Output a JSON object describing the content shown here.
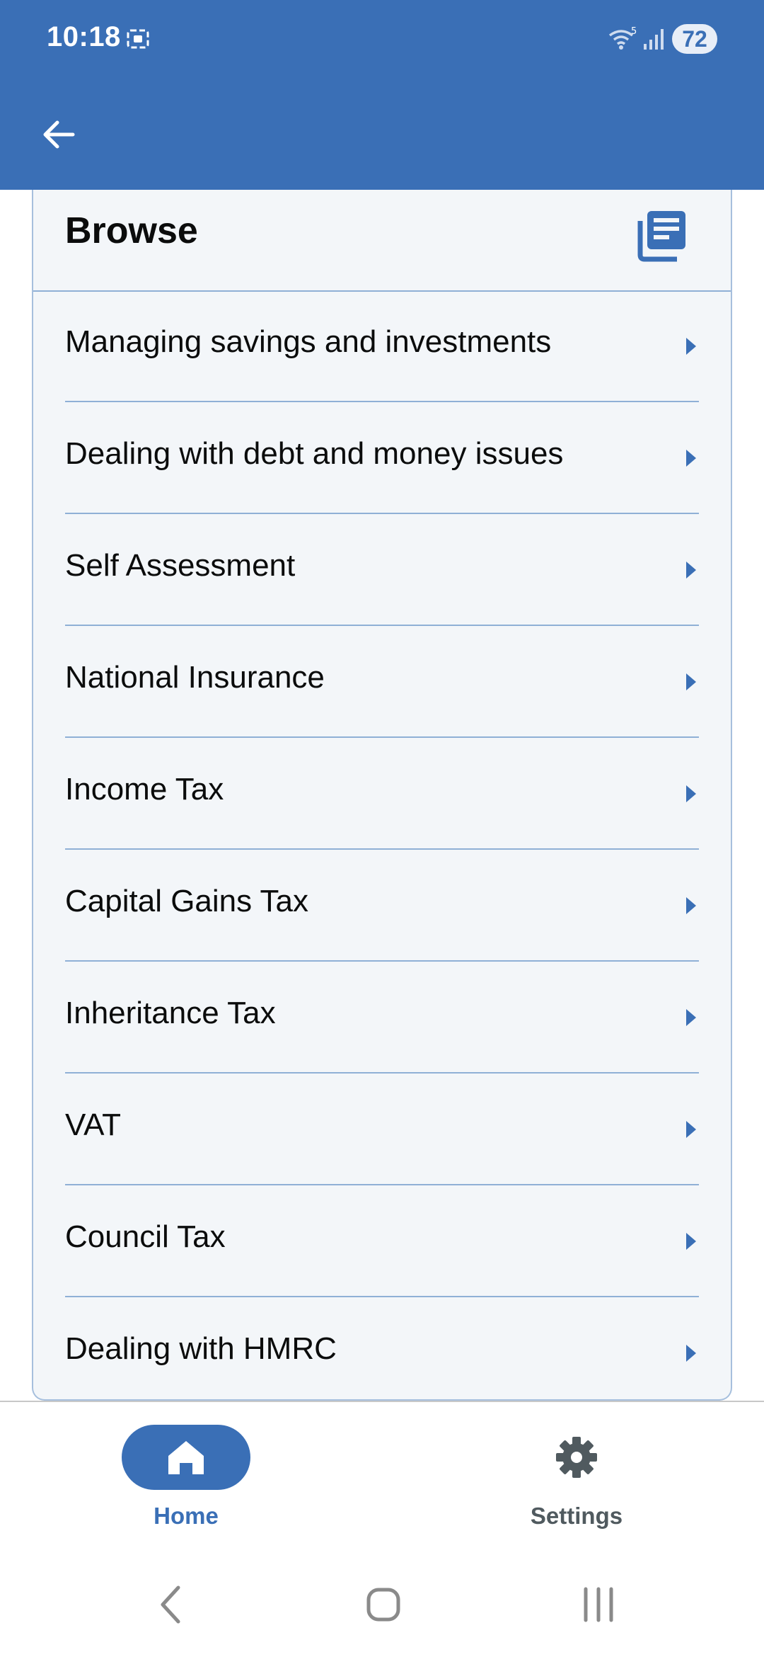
{
  "status_bar": {
    "time": "10:18",
    "battery": "72",
    "wifi_label": "5"
  },
  "app_bar": {
    "back_icon": "arrow-left-icon"
  },
  "browse": {
    "title": "Browse",
    "icon": "article-list-icon",
    "items": [
      {
        "label": "Managing savings and investments"
      },
      {
        "label": "Dealing with debt and money issues"
      },
      {
        "label": "Self Assessment"
      },
      {
        "label": "National Insurance"
      },
      {
        "label": "Income Tax"
      },
      {
        "label": "Capital Gains Tax"
      },
      {
        "label": "Inheritance Tax"
      },
      {
        "label": "VAT"
      },
      {
        "label": "Council Tax"
      },
      {
        "label": "Dealing with HMRC"
      }
    ]
  },
  "bottom_nav": {
    "home_label": "Home",
    "settings_label": "Settings",
    "active": "home"
  },
  "colors": {
    "brand": "#3a6fb6",
    "card_bg": "#f3f6f9",
    "divider": "#8fb0d6"
  }
}
